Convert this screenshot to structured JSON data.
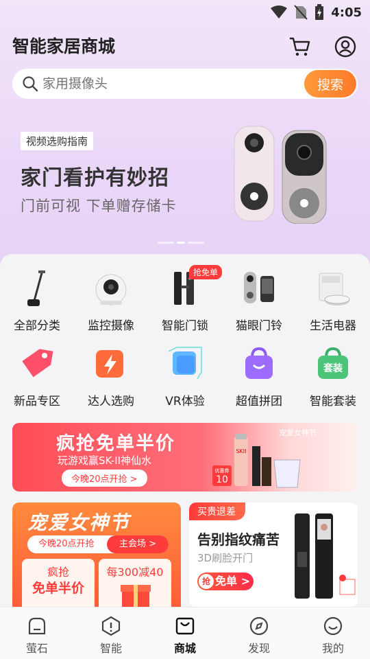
{
  "status_bar": {
    "time": "4:05"
  },
  "header": {
    "title": "智能家居商城"
  },
  "search": {
    "placeholder": "家用摄像头",
    "button": "搜索"
  },
  "banner": {
    "tag": "视频选购指南",
    "title": "家门看护有妙招",
    "subtitle": "门前可视  下单赠存储卡"
  },
  "categories": {
    "row1": [
      {
        "label": "全部分类",
        "icon": "vacuum-icon"
      },
      {
        "label": "监控摄像",
        "icon": "camera-icon"
      },
      {
        "label": "智能门锁",
        "icon": "door-lock-icon",
        "badge": "抢免单"
      },
      {
        "label": "猫眼门铃",
        "icon": "doorbell-icon"
      },
      {
        "label": "生活电器",
        "icon": "robot-vacuum-icon"
      }
    ],
    "row2": [
      {
        "label": "新品专区",
        "icon": "tag-icon"
      },
      {
        "label": "达人选购",
        "icon": "lightning-icon"
      },
      {
        "label": "VR体验",
        "icon": "vr-cube-icon"
      },
      {
        "label": "超值拼团",
        "icon": "shopping-bag-icon"
      },
      {
        "label": "智能套装",
        "icon": "bundle-bag-icon",
        "icon_text": "套装"
      }
    ]
  },
  "promo": {
    "title": "疯抢免单半价",
    "subtitle": "玩游戏赢SK-II神仙水",
    "button": "今晚20点开抢 >",
    "tag": "宠爱女神节",
    "coupon_label": "优惠券",
    "coupon_value": "10",
    "product_text": "SKII"
  },
  "card_left": {
    "title": "宠爱女神节",
    "pill_left": "今晚20点开抢",
    "pill_right": "主会场 >",
    "sub1_line1": "疯抢",
    "sub1_line2": "免单半价",
    "sub2_line1": "每300减40"
  },
  "card_right": {
    "tag": "买贵退差",
    "title": "告别指纹痛苦",
    "subtitle": "3D刷脸开门",
    "button_badge": "抢",
    "button": "免单 >"
  },
  "tabs": [
    {
      "label": "萤石",
      "icon": "home-shape-icon"
    },
    {
      "label": "智能",
      "icon": "smart-icon"
    },
    {
      "label": "商城",
      "icon": "bag-icon",
      "active": true
    },
    {
      "label": "发现",
      "icon": "compass-icon"
    },
    {
      "label": "我的",
      "icon": "smile-icon"
    }
  ],
  "colors": {
    "accent": "#ff7a2a",
    "promo_red": "#ff3b3b",
    "banner_bg": "#ead7f8"
  }
}
